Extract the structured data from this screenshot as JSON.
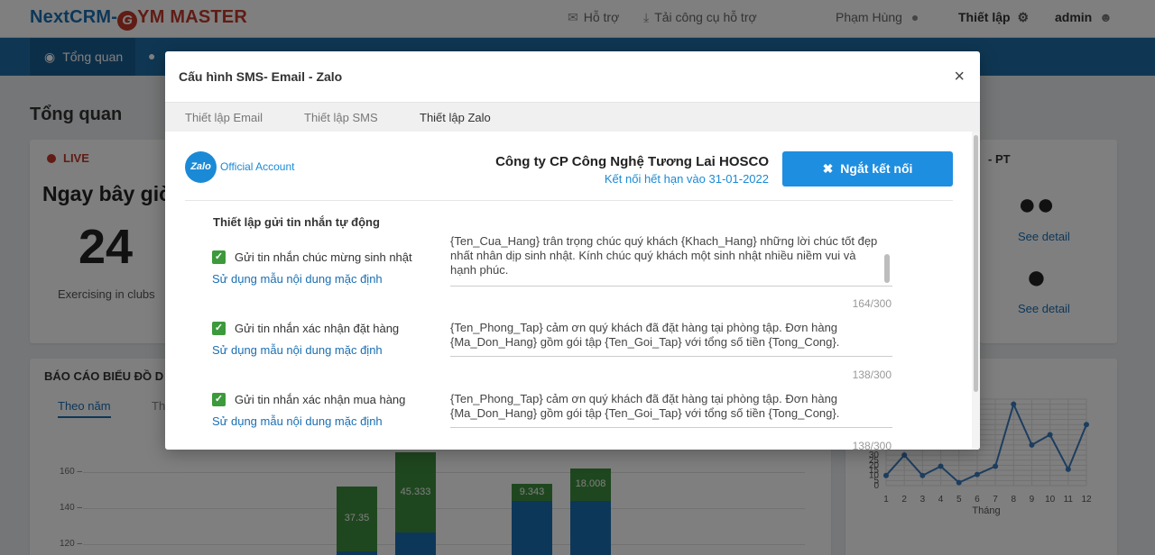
{
  "header": {
    "logo": {
      "part1": "NextCRM-",
      "g": "G",
      "part2": "YM MASTER"
    },
    "support": "Hỗ trợ",
    "download_tools": "Tải công cụ hỗ trợ",
    "user_name": "Phạm Hùng",
    "settings": "Thiết lập",
    "account": "admin"
  },
  "nav": {
    "overview": "Tổng quan"
  },
  "dashboard": {
    "title": "Tổng quan",
    "live": "LIVE",
    "now": "Ngay bây giờ",
    "count": "24",
    "exercising": "Exercising in clubs",
    "pt_title": "- PT",
    "see_detail": "See detail",
    "bar_chart_title": "BÁO CÁO BIỂU ĐỒ D",
    "tab_year": "Theo năm",
    "tab_other": "Th",
    "month_axis": "Tháng"
  },
  "chart_data": [
    {
      "type": "bar",
      "title": "BÁO CÁO BIỂU ĐỒ D",
      "ylabel": "",
      "yticks": [
        120,
        140,
        160
      ],
      "stacked": true,
      "visible_labels": [
        "37.35",
        "45.333",
        "9.343",
        "18.008"
      ]
    },
    {
      "type": "line",
      "xlabel": "Tháng",
      "x": [
        1,
        2,
        3,
        4,
        5,
        6,
        7,
        8,
        9,
        10,
        11,
        12
      ],
      "yticks": [
        0,
        5,
        10,
        15,
        20,
        25,
        30
      ],
      "ylim": [
        0,
        30
      ],
      "values": [
        10,
        30,
        10,
        19,
        3,
        11,
        19,
        80,
        40,
        50,
        16,
        60
      ],
      "color": "#3a7bbf"
    }
  ],
  "modal": {
    "title": "Cấu hình SMS- Email - Zalo",
    "close": "×",
    "tabs": [
      "Thiết lập Email",
      "Thiết lập SMS",
      "Thiết lập Zalo"
    ],
    "active_tab": "Thiết lập Zalo",
    "zalo_badge": "Zalo",
    "official_account": "Official Account",
    "company": "Công ty CP Công Nghệ Tương Lai HOSCO",
    "expiry": "Kết nối hết hạn vào 31-01-2022",
    "disconnect": "Ngắt kết nối",
    "section_title": "Thiết lập gửi tin nhắn tự động",
    "items": [
      {
        "label": "Gửi tin nhắn chúc mừng sinh nhật",
        "use_default": "Sử dụng mẫu nội dung mặc định",
        "message": "{Ten_Cua_Hang} trân trọng chúc quý khách {Khach_Hang} những lời chúc tốt đẹp nhất nhân dịp sinh nhật. Kính chúc quý khách một sinh nhật nhiều niềm vui và hạnh phúc.",
        "counter": "164/300"
      },
      {
        "label": "Gửi tin nhắn xác nhận đặt hàng",
        "use_default": "Sử dụng mẫu nội dung mặc định",
        "message": "{Ten_Phong_Tap} cảm ơn quý khách đã đặt hàng tại phòng tập. Đơn hàng {Ma_Don_Hang} gồm gói tập {Ten_Goi_Tap} với tổng số tiền {Tong_Cong}.",
        "counter": "138/300"
      },
      {
        "label": "Gửi tin nhắn xác nhận mua hàng",
        "use_default": "Sử dụng mẫu nội dung mặc định",
        "message": "{Ten_Phong_Tap} cảm ơn quý khách đã đặt hàng tại phòng tập. Đơn hàng {Ma_Don_Hang} gồm gói tập {Ten_Goi_Tap} với tổng số tiền {Tong_Cong}.",
        "counter": "138/300"
      }
    ]
  },
  "colors": {
    "brand_blue": "#1e6ea7",
    "button_blue": "#1e8ee0",
    "check_green": "#3c9a3c",
    "bar_green": "#3e8e3e",
    "bar_blue": "#1a6fb3"
  }
}
